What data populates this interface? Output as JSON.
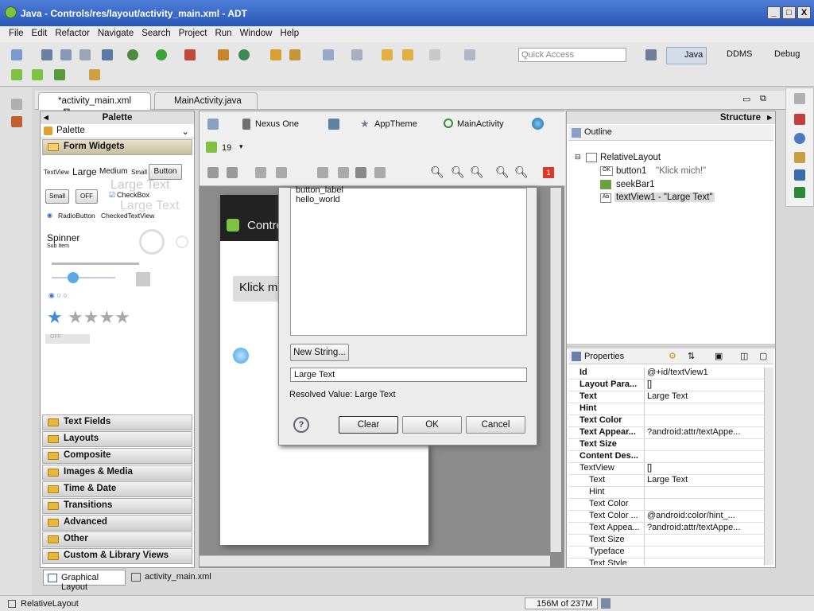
{
  "window": {
    "title": "Java - Controls/res/layout/activity_main.xml - ADT",
    "buttons": [
      "_",
      "□",
      "X"
    ]
  },
  "menu": [
    "File",
    "Edit",
    "Refactor",
    "Navigate",
    "Search",
    "Project",
    "Run",
    "Window",
    "Help"
  ],
  "toolbar": {
    "quick_access_placeholder": "Quick Access",
    "perspectives": [
      "Java",
      "DDMS",
      "Debug"
    ]
  },
  "editor_tabs": [
    {
      "label": "*activity_main.xml",
      "active": true
    },
    {
      "label": "MainActivity.java",
      "active": false
    }
  ],
  "palette": {
    "header": "Palette",
    "subheader": "Palette",
    "open_category": "Form Widgets",
    "widgets": {
      "textview": "TextView",
      "large": "Large",
      "medium": "Medium",
      "small": "Small",
      "button": "Button",
      "large_text": "Large Text",
      "small_btn": "Small",
      "off": "OFF",
      "checkbox": "CheckBox",
      "radiobutton": "RadioButton",
      "checkedtextview": "CheckedTextView",
      "spinner": "Spinner",
      "sub_item": "Sub Item"
    },
    "categories": [
      "Text Fields",
      "Layouts",
      "Composite",
      "Images & Media",
      "Time & Date",
      "Transitions",
      "Advanced",
      "Other",
      "Custom & Library Views"
    ]
  },
  "canvas_toolbar": {
    "device": "Nexus One",
    "theme": "AppTheme",
    "activity": "MainActivity",
    "api": "19",
    "error_count": "1"
  },
  "device_preview": {
    "app_title": "Contro",
    "button_text": "Klick m"
  },
  "dialog": {
    "list_items": [
      "button_label",
      "hello_world"
    ],
    "new_string_button": "New String...",
    "text_value": "Large Text",
    "resolved_value": "Resolved Value: Large Text",
    "clear_button": "Clear",
    "ok_button": "OK",
    "cancel_button": "Cancel"
  },
  "structure": {
    "header": "Structure",
    "outline_label": "Outline",
    "tree": [
      {
        "label": "RelativeLayout",
        "detail": ""
      },
      {
        "label": "button1",
        "detail": "\"Klick mich!\""
      },
      {
        "label": "seekBar1",
        "detail": ""
      },
      {
        "label": "textView1 - \"Large Text\"",
        "detail": ""
      }
    ]
  },
  "properties": {
    "header": "Properties",
    "rows": [
      {
        "key": "Id",
        "value": "@+id/textView1"
      },
      {
        "key": "Layout Para...",
        "value": "[]"
      },
      {
        "key": "Text",
        "value": "Large Text"
      },
      {
        "key": "Hint",
        "value": ""
      },
      {
        "key": "Text Color",
        "value": ""
      },
      {
        "key": "Text Appear...",
        "value": "?android:attr/textAppe..."
      },
      {
        "key": "Text Size",
        "value": ""
      },
      {
        "key": "Content Des...",
        "value": ""
      },
      {
        "key": "TextView",
        "value": "[]"
      },
      {
        "key": "Text",
        "value": "Large Text"
      },
      {
        "key": "Hint",
        "value": ""
      },
      {
        "key": "Text Color",
        "value": ""
      },
      {
        "key": "Text Color ...",
        "value": "@android:color/hint_..."
      },
      {
        "key": "Text Appea...",
        "value": "?android:attr/textAppe..."
      },
      {
        "key": "Text Size",
        "value": ""
      },
      {
        "key": "Typeface",
        "value": ""
      },
      {
        "key": "Text Style",
        "value": ""
      }
    ]
  },
  "bottom_tabs": [
    "Graphical Layout",
    "activity_main.xml"
  ],
  "status": {
    "left": "RelativeLayout",
    "memory": "156M of 237M"
  },
  "colors": {
    "title_bar": "#2f5fc4",
    "folder": "#e8b83a",
    "android_green": "#7dc243",
    "star": "#3b8ed8"
  }
}
